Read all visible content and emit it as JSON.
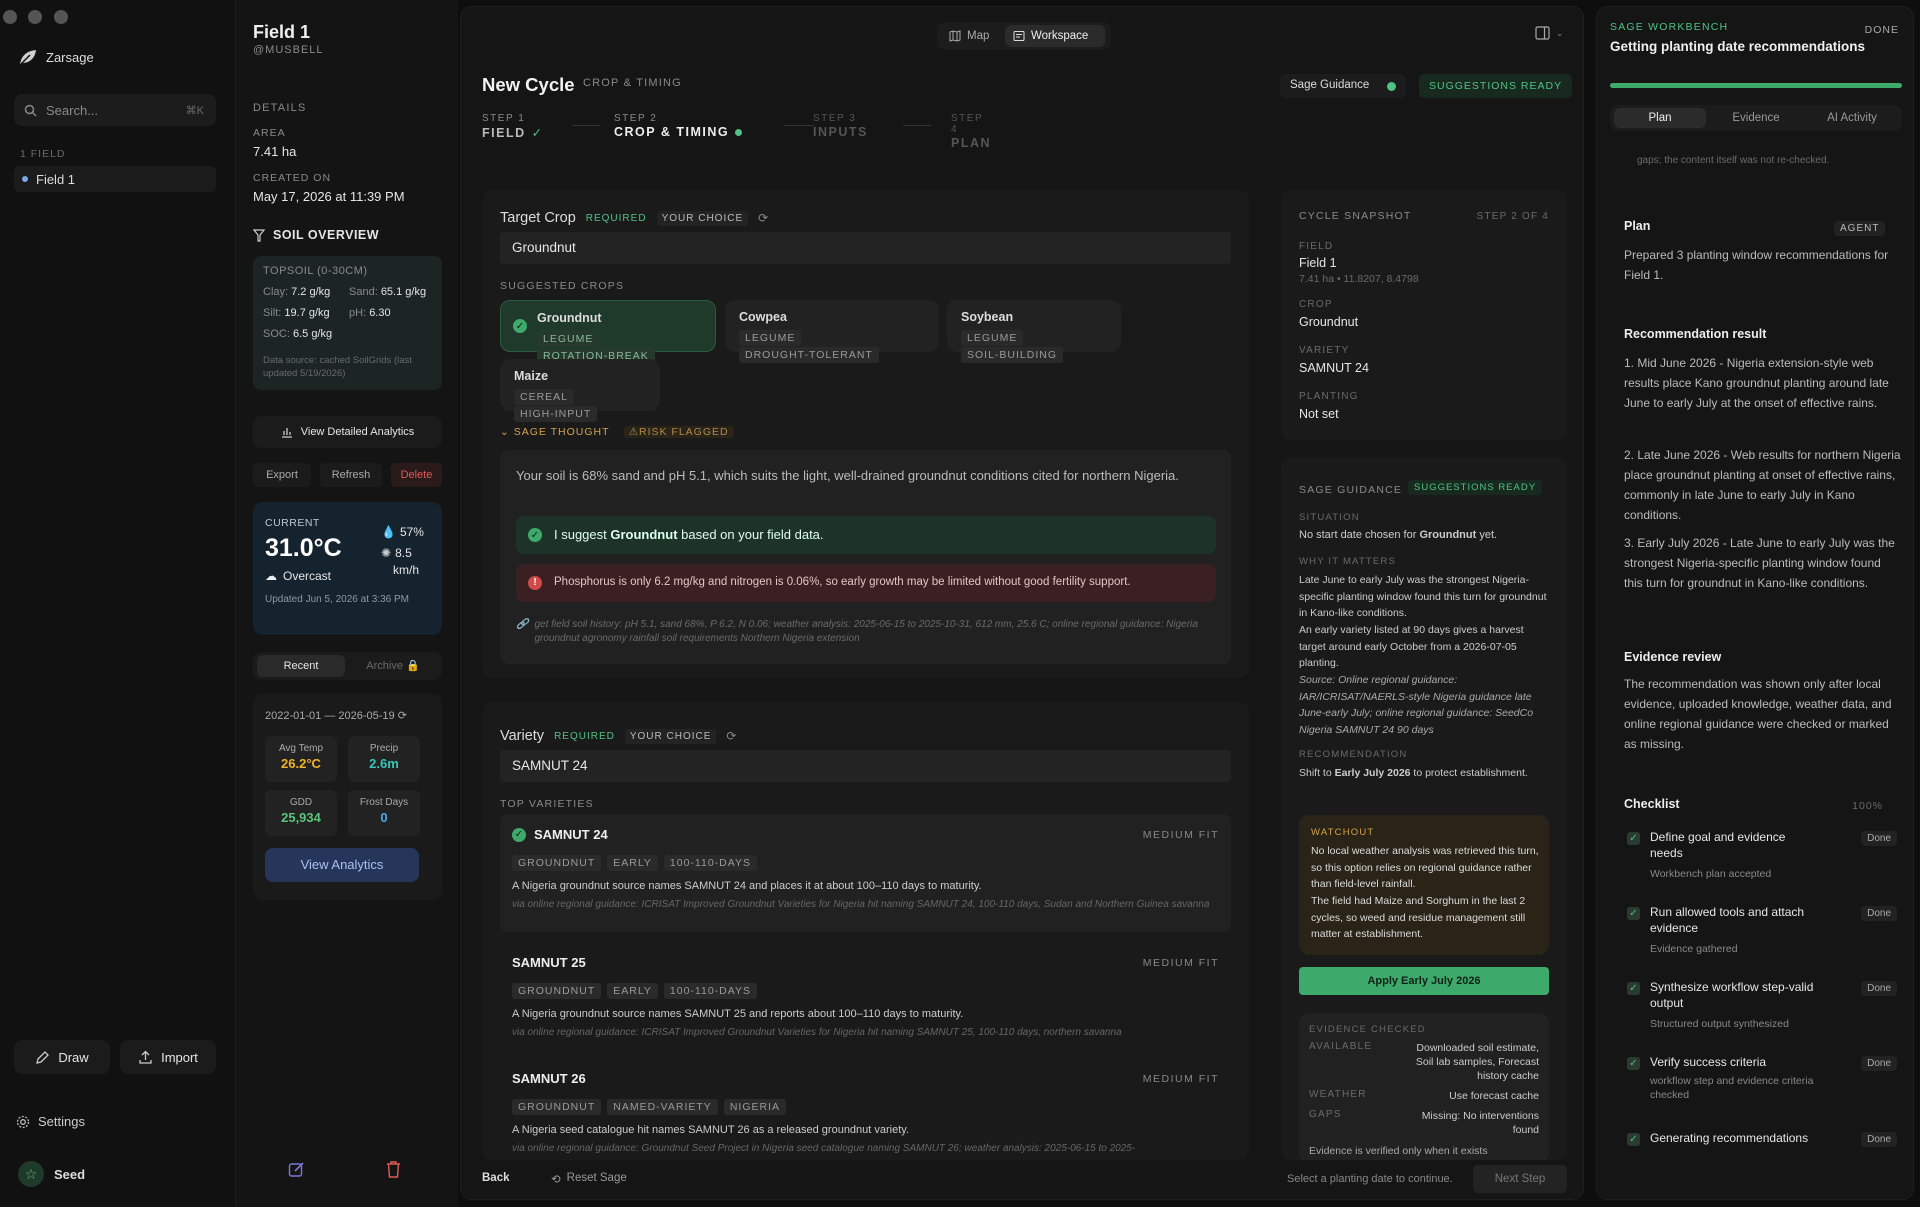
{
  "app": {
    "name": "Zarsage",
    "search_placeholder": "Search...",
    "search_shortcut": "⌘K",
    "fields_heading": "1 FIELD",
    "field_item": "Field 1",
    "draw": "Draw",
    "import": "Import",
    "settings": "Settings",
    "seed": "Seed"
  },
  "field": {
    "title": "Field 1",
    "owner": "@MUSBELL",
    "details_heading": "DETAILS",
    "area_label": "AREA",
    "area": "7.41 ha",
    "created_label": "CREATED ON",
    "created": "May 17, 2026 at 11:39 PM",
    "soil_heading": "SOIL OVERVIEW",
    "topsoil": "TOPSOIL (0-30CM)",
    "clay_label": "Clay:",
    "clay": "7.2 g/kg",
    "sand_label": "Sand:",
    "sand": "65.1 g/kg",
    "silt_label": "Silt:",
    "silt": "19.7 g/kg",
    "ph_label": "pH:",
    "ph": "6.30",
    "soc_label": "SOC:",
    "soc": "6.5 g/kg",
    "soil_source": "Data source: cached SoilGrids (last updated 5/19/2026)",
    "analytics_btn": "View Detailed Analytics",
    "export": "Export",
    "refresh": "Refresh",
    "delete": "Delete",
    "weather": {
      "label": "CURRENT",
      "temp": "31.0°C",
      "humidity": "57%",
      "wind": "8.5",
      "wind_unit": "km/h",
      "cond": "Overcast",
      "updated": "Updated Jun 5, 2026 at 3:36 PM"
    },
    "tabs": {
      "recent": "Recent",
      "archive": "Archive"
    },
    "range": "2022-01-01 — 2026-05-19",
    "stats": [
      {
        "label": "Avg Temp",
        "value": "26.2°C",
        "color": "#f0b429"
      },
      {
        "label": "Precip",
        "value": "2.6m",
        "color": "#38c6b8"
      },
      {
        "label": "GDD",
        "value": "25,934",
        "color": "#5ac27a"
      },
      {
        "label": "Frost Days",
        "value": "0",
        "color": "#4aa8e8"
      }
    ],
    "view_analytics": "View Analytics"
  },
  "header": {
    "map": "Map",
    "workspace": "Workspace"
  },
  "cycle": {
    "title": "New Cycle",
    "subtitle": "CROP & TIMING",
    "guidance": "Sage Guidance",
    "ready": "SUGGESTIONS READY",
    "steps": [
      {
        "num": "STEP 1",
        "name": "FIELD"
      },
      {
        "num": "STEP 2",
        "name": "CROP & TIMING"
      },
      {
        "num": "STEP 3",
        "name": "INPUTS"
      },
      {
        "num": "STEP 4",
        "name": "PLAN"
      }
    ],
    "target_label": "Target Crop",
    "required": "REQUIRED",
    "your_choice": "YOUR CHOICE",
    "target_value": "Groundnut",
    "suggested_label": "SUGGESTED CROPS",
    "crops": [
      {
        "name": "Groundnut",
        "tags": [
          "LEGUME",
          "ROTATION-BREAK"
        ]
      },
      {
        "name": "Cowpea",
        "tags": [
          "LEGUME",
          "DROUGHT-TOLERANT"
        ]
      },
      {
        "name": "Soybean",
        "tags": [
          "LEGUME",
          "SOIL-BUILDING"
        ]
      },
      {
        "name": "Maize",
        "tags": [
          "CEREAL",
          "HIGH-INPUT"
        ]
      }
    ],
    "thought_label": "SAGE THOUGHT",
    "risk": "RISK FLAGGED",
    "thought_text": "Your soil is 68% sand and pH 5.1, which suits the light, well-drained groundnut conditions cited for northern Nigeria.",
    "suggest_pre": "I suggest ",
    "suggest_crop": "Groundnut",
    "suggest_post": " based on your field data.",
    "warning": "Phosphorus is only 6.2 mg/kg and nitrogen is 0.06%, so early growth may be limited without good fertility support.",
    "sources": "get field soil history: pH 5.1, sand 68%, P 6.2, N 0.06; weather analysis: 2025-06-15 to 2025-10-31, 612 mm, 25.6 C; online regional guidance: Nigeria groundnut agronomy rainfall soil requirements Northern Nigeria extension",
    "variety_label": "Variety",
    "variety_value": "SAMNUT 24",
    "top_label": "TOP VARIETIES",
    "varieties": [
      {
        "name": "SAMNUT 24",
        "fit": "MEDIUM FIT",
        "tags": [
          "GROUNDNUT",
          "EARLY",
          "100-110-DAYS"
        ],
        "desc": "A Nigeria groundnut source names SAMNUT 24 and places it at about 100–110 days to maturity.",
        "src": "via online regional guidance: ICRISAT Improved Groundnut Varieties for Nigeria hit naming SAMNUT 24, 100-110 days, Sudan and Northern Guinea savanna"
      },
      {
        "name": "SAMNUT 25",
        "fit": "MEDIUM FIT",
        "tags": [
          "GROUNDNUT",
          "EARLY",
          "100-110-DAYS"
        ],
        "desc": "A Nigeria groundnut source names SAMNUT 25 and reports about 100–110 days to maturity.",
        "src": "via online regional guidance: ICRISAT Improved Groundnut Varieties for Nigeria hit naming SAMNUT 25, 100-110 days, northern savanna"
      },
      {
        "name": "SAMNUT 26",
        "fit": "MEDIUM FIT",
        "tags": [
          "GROUNDNUT",
          "NAMED-VARIETY",
          "NIGERIA"
        ],
        "desc": "A Nigeria seed catalogue hit names SAMNUT 26 as a released groundnut variety.",
        "src": "via online regional guidance: Groundnut Seed Project in Nigeria seed catalogue naming SAMNUT 26; weather analysis: 2025-06-15 to 2025-"
      }
    ],
    "back": "Back",
    "reset": "Reset Sage",
    "select_hint": "Select a planting date to continue.",
    "next": "Next Step"
  },
  "snapshot": {
    "title": "CYCLE SNAPSHOT",
    "step": "STEP 2 OF 4",
    "field_label": "FIELD",
    "field": "Field 1",
    "field_sub": "7.41 ha • 11.8207, 8.4798",
    "crop_label": "CROP",
    "crop": "Groundnut",
    "variety_label": "VARIETY",
    "variety": "SAMNUT 24",
    "planting_label": "PLANTING",
    "planting": "Not set"
  },
  "guidance": {
    "title": "SAGE GUIDANCE",
    "ready": "SUGGESTIONS READY",
    "situation_label": "SITUATION",
    "situation_pre": "No start date chosen for ",
    "situation_crop": "Groundnut",
    "situation_post": " yet.",
    "why_label": "WHY IT MATTERS",
    "why1": "Late June to early July was the strongest Nigeria-specific planting window found this turn for groundnut in Kano-like conditions.",
    "why2": "An early variety listed at 90 days gives a harvest target around early October from a 2026-07-05 planting.",
    "why_src": "Source: Online regional guidance: IAR/ICRISAT/NAERLS-style Nigeria guidance late June-early July; online regional guidance: SeedCo Nigeria SAMNUT 24 90 days",
    "rec_label": "RECOMMENDATION",
    "rec_pre": "Shift to ",
    "rec_bold": "Early July 2026",
    "rec_post": " to protect establishment.",
    "watch_label": "WATCHOUT",
    "watch1": "No local weather analysis was retrieved this turn, so this option relies on regional guidance rather than field-level rainfall.",
    "watch2": "The field had Maize and Sorghum in the last 2 cycles, so weed and residue management still matter at establishment.",
    "apply": "Apply Early July 2026",
    "evidence_label": "EVIDENCE CHECKED",
    "ev": [
      {
        "k": "AVAILABLE",
        "v": "Downloaded soil estimate, Soil lab samples, Forecast history cache"
      },
      {
        "k": "WEATHER",
        "v": "Use forecast cache"
      },
      {
        "k": "GAPS",
        "v": "Missing: No interventions found"
      }
    ],
    "ev_foot": "Evidence is verified only when it exists"
  },
  "workbench": {
    "label": "SAGE WORKBENCH",
    "done": "DONE",
    "title": "Getting planting date recommendations",
    "progress": 1.0,
    "tabs": [
      "Plan",
      "Evidence",
      "AI Activity"
    ],
    "top_note": "gaps; the content itself was not re-checked.",
    "plan_title": "Plan",
    "agent": "AGENT",
    "plan_text": "Prepared 3 planting window recommendations for Field 1.",
    "rec_title": "Recommendation result",
    "recs": [
      "1. Mid June 2026 - Nigeria extension-style web results place Kano groundnut planting around late June to early July at the onset of effective rains.",
      "2. Late June 2026 - Web results for northern Nigeria place groundnut planting at onset of effective rains, commonly in late June to early July in Kano conditions.",
      "3. Early July 2026 - Late June to early July was the strongest Nigeria-specific planting window found this turn for groundnut in Kano-like conditions."
    ],
    "ev_title": "Evidence review",
    "ev_text": "The recommendation was shown only after local evidence, uploaded knowledge, weather data, and online regional guidance were checked or marked as missing.",
    "checklist_title": "Checklist",
    "checklist_pct": "100%",
    "checklist": [
      {
        "t": "Define goal and evidence needs",
        "s": "Workbench plan accepted",
        "st": "Done"
      },
      {
        "t": "Run allowed tools and attach evidence",
        "s": "Evidence gathered",
        "st": "Done"
      },
      {
        "t": "Synthesize workflow step-valid output",
        "s": "Structured output synthesized",
        "st": "Done"
      },
      {
        "t": "Verify success criteria",
        "s": "workflow step and evidence criteria checked",
        "st": "Done"
      },
      {
        "t": "Generating recommendations",
        "s": "",
        "st": "Done"
      }
    ]
  }
}
